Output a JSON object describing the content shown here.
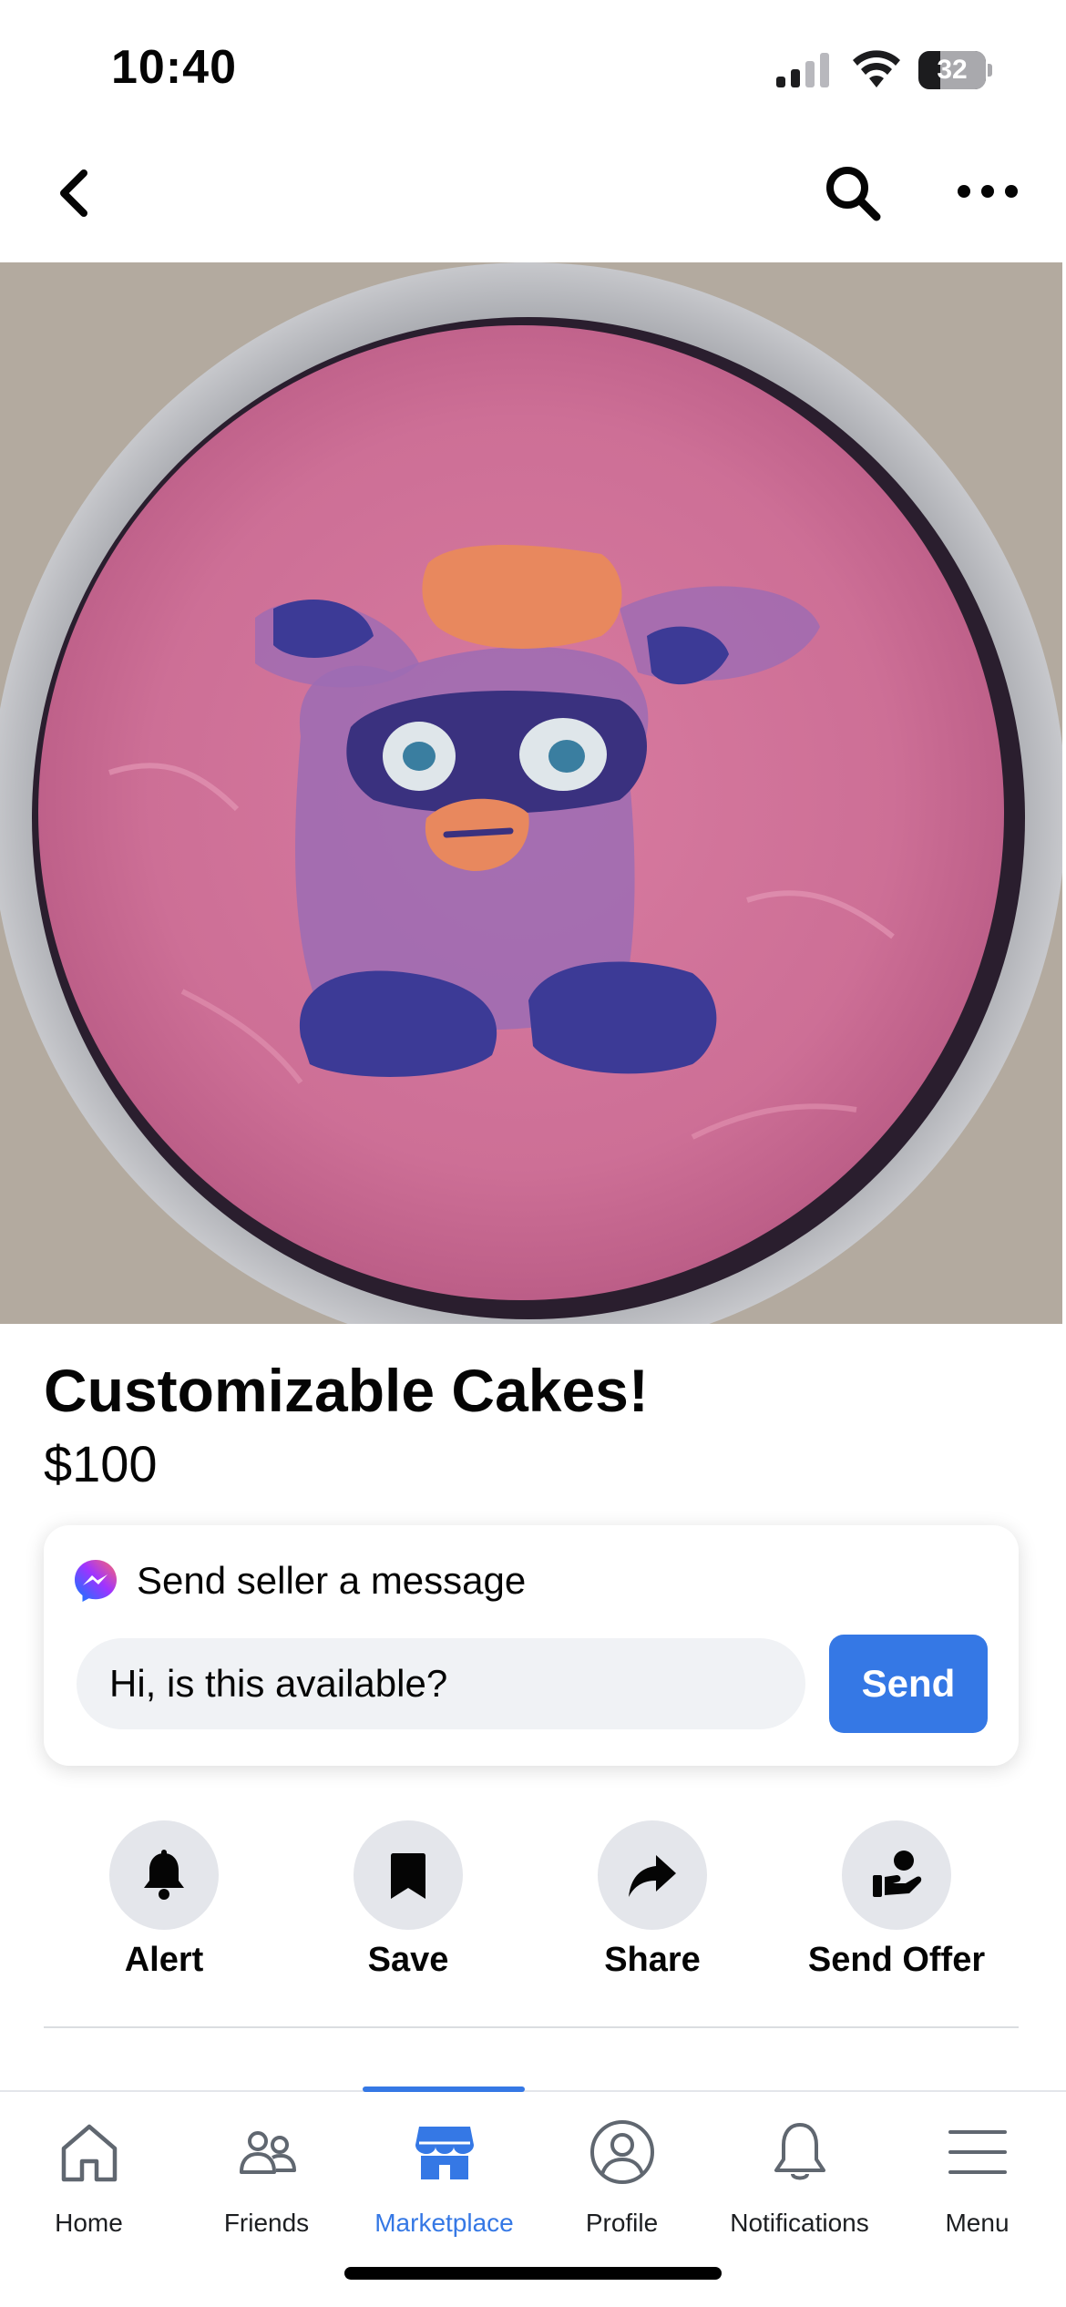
{
  "status_bar": {
    "time": "10:40",
    "battery": "32",
    "battery_level": 0.32
  },
  "nav": {
    "back_icon": "chevron-left-icon",
    "search_icon": "search-icon",
    "more_icon": "more-dots-icon"
  },
  "listing": {
    "title": "Customizable Cakes!",
    "price": "$100"
  },
  "message_card": {
    "icon": "messenger-icon",
    "label": "Send seller a message",
    "input_value": "Hi, is this available?",
    "send_label": "Send"
  },
  "actions": [
    {
      "label": "Alert",
      "icon": "bell-icon"
    },
    {
      "label": "Save",
      "icon": "bookmark-icon"
    },
    {
      "label": "Share",
      "icon": "share-arrow-icon"
    },
    {
      "label": "Send Offer",
      "icon": "offer-hand-icon"
    }
  ],
  "tabs": [
    {
      "label": "Home",
      "icon": "home-icon"
    },
    {
      "label": "Friends",
      "icon": "friends-icon"
    },
    {
      "label": "Marketplace",
      "icon": "marketplace-icon",
      "active": true
    },
    {
      "label": "Profile",
      "icon": "profile-icon"
    },
    {
      "label": "Notifications",
      "icon": "bell-icon"
    },
    {
      "label": "Menu",
      "icon": "menu-icon"
    }
  ],
  "colors": {
    "accent": "#3578e5",
    "button_bg": "#e4e6eb",
    "input_bg": "#f0f2f5"
  }
}
